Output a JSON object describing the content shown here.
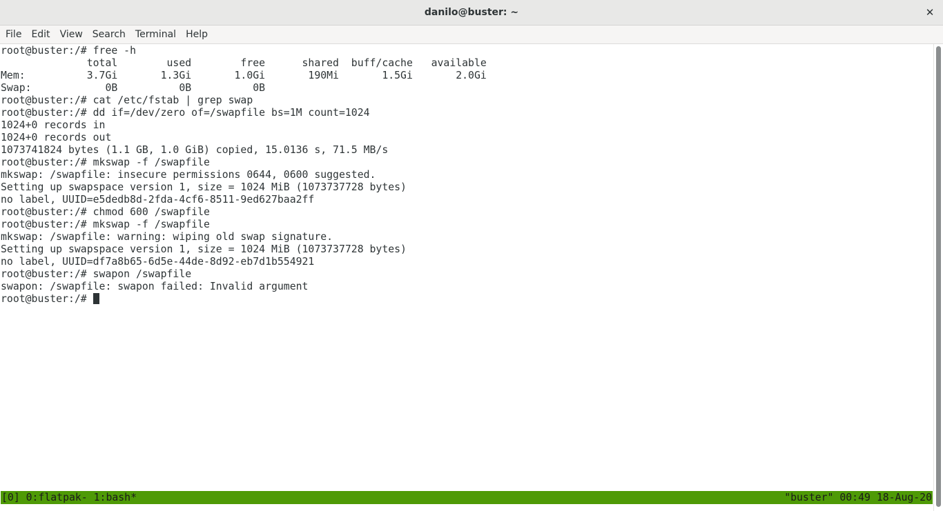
{
  "window": {
    "title": "danilo@buster: ~",
    "close_glyph": "✕"
  },
  "menubar": {
    "items": [
      "File",
      "Edit",
      "View",
      "Search",
      "Terminal",
      "Help"
    ]
  },
  "terminal": {
    "lines": [
      "root@buster:/# free -h",
      "              total        used        free      shared  buff/cache   available",
      "Mem:          3.7Gi       1.3Gi       1.0Gi       190Mi       1.5Gi       2.0Gi",
      "Swap:            0B          0B          0B",
      "root@buster:/# cat /etc/fstab | grep swap",
      "root@buster:/# dd if=/dev/zero of=/swapfile bs=1M count=1024",
      "1024+0 records in",
      "1024+0 records out",
      "1073741824 bytes (1.1 GB, 1.0 GiB) copied, 15.0136 s, 71.5 MB/s",
      "root@buster:/# mkswap -f /swapfile",
      "mkswap: /swapfile: insecure permissions 0644, 0600 suggested.",
      "Setting up swapspace version 1, size = 1024 MiB (1073737728 bytes)",
      "no label, UUID=e5dedb8d-2fda-4cf6-8511-9ed627baa2ff",
      "root@buster:/# chmod 600 /swapfile",
      "root@buster:/# mkswap -f /swapfile",
      "mkswap: /swapfile: warning: wiping old swap signature.",
      "Setting up swapspace version 1, size = 1024 MiB (1073737728 bytes)",
      "no label, UUID=df7a8b65-6d5e-44de-8d92-eb7d1b554921",
      "root@buster:/# swapon /swapfile",
      "swapon: /swapfile: swapon failed: Invalid argument"
    ],
    "prompt": "root@buster:/# "
  },
  "tmux_status": {
    "left": "[0] 0:flatpak- 1:bash*",
    "right": "\"buster\" 00:49 18-Aug-20",
    "color": "#4e9a06"
  }
}
